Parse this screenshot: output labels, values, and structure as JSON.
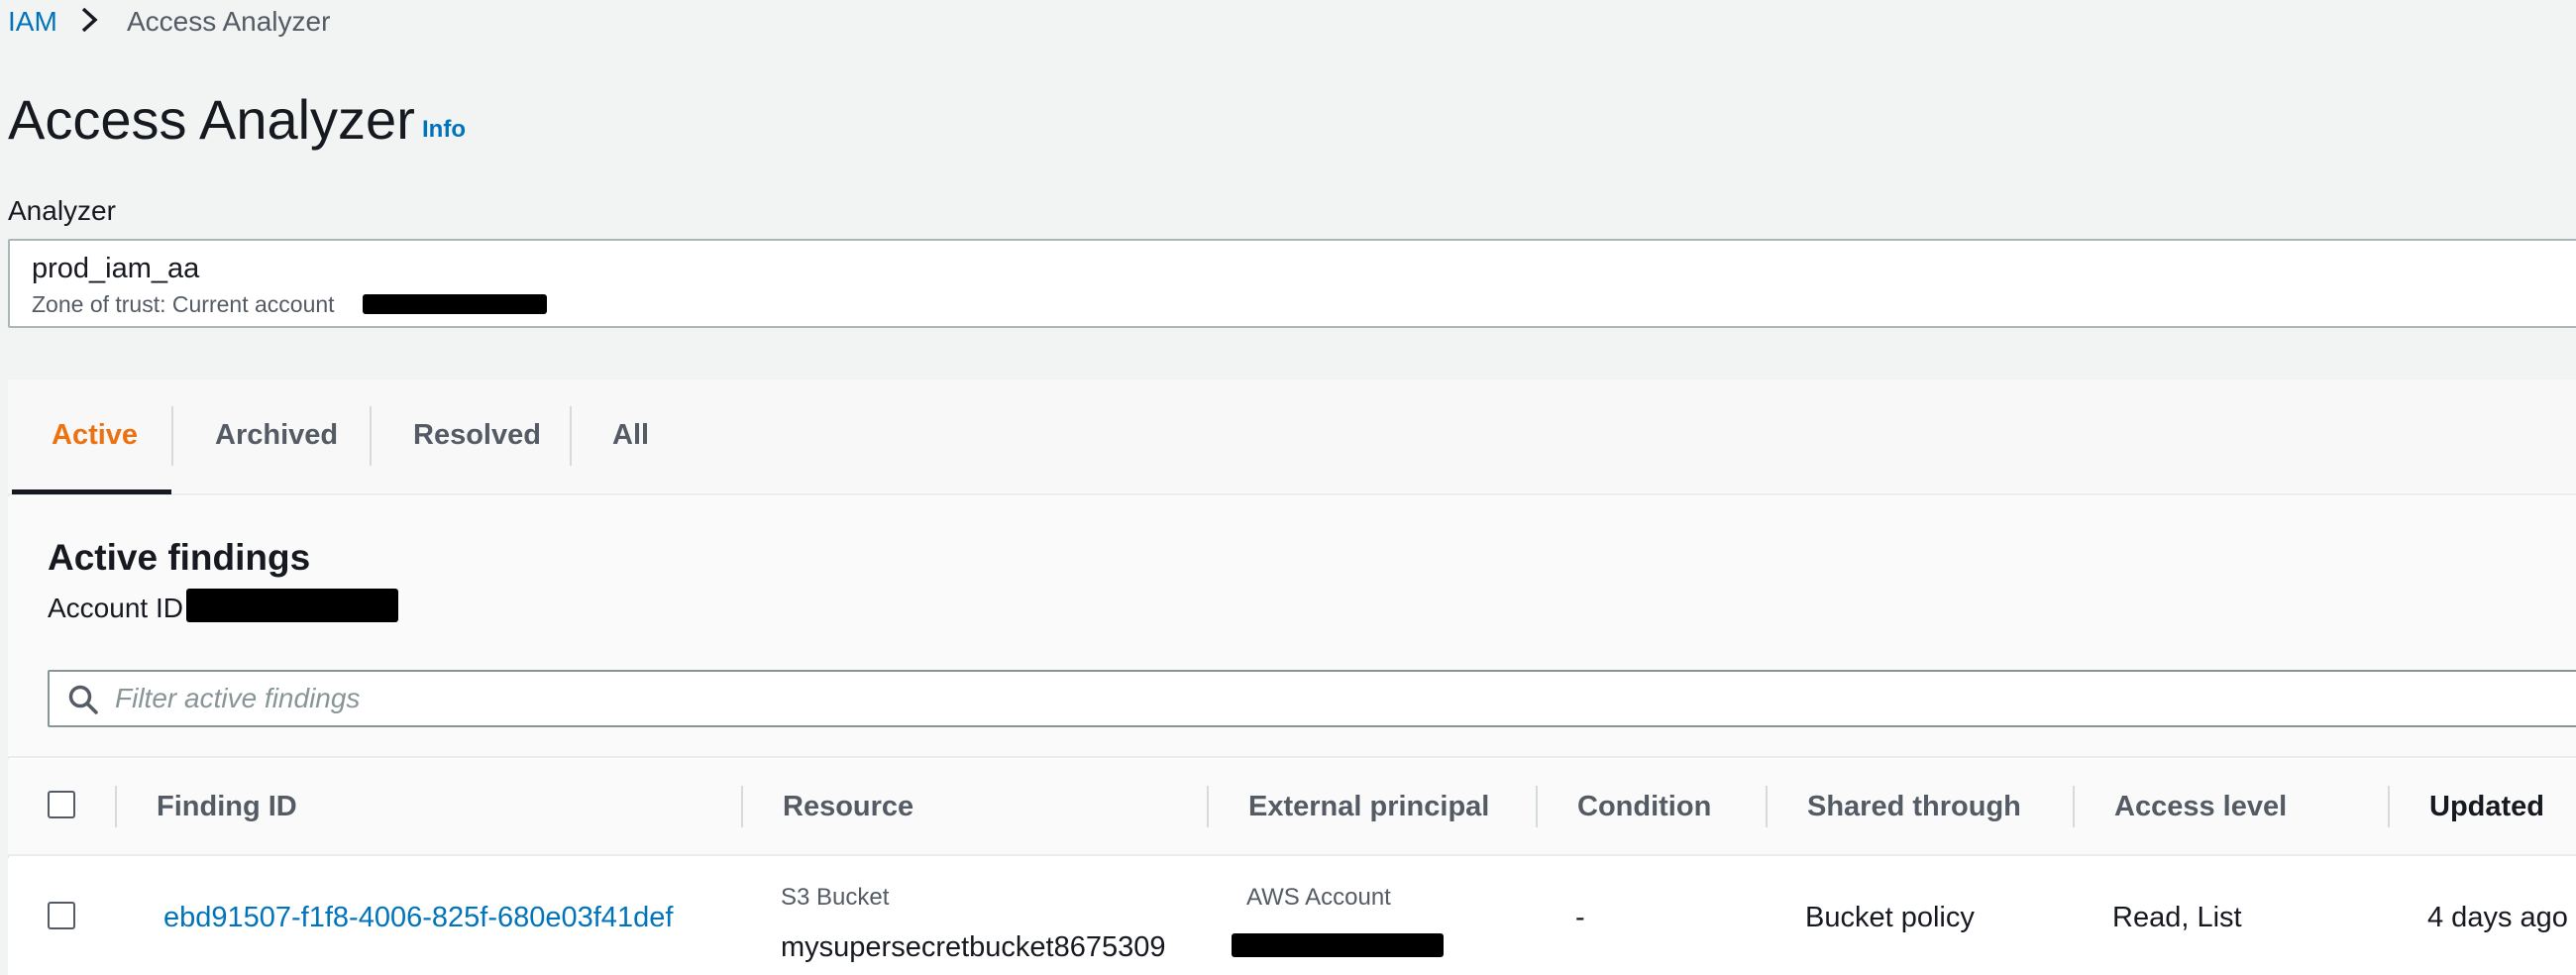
{
  "breadcrumb": {
    "root": "IAM",
    "current": "Access Analyzer"
  },
  "page": {
    "title": "Access Analyzer",
    "info_label": "Info"
  },
  "analyzer": {
    "label": "Analyzer",
    "name": "prod_iam_aa",
    "zone_label": "Zone of trust: Current account"
  },
  "tabs": [
    {
      "label": "Active",
      "active": true
    },
    {
      "label": "Archived",
      "active": false
    },
    {
      "label": "Resolved",
      "active": false
    },
    {
      "label": "All",
      "active": false
    }
  ],
  "findings": {
    "title": "Active findings",
    "account_label": "Account ID",
    "filter_placeholder": "Filter active findings"
  },
  "table": {
    "columns": [
      "Finding ID",
      "Resource",
      "External principal",
      "Condition",
      "Shared through",
      "Access level",
      "Updated"
    ],
    "rows": [
      {
        "finding_id": "ebd91507-f1f8-4006-825f-680e03f41def",
        "resource_type": "S3 Bucket",
        "resource_name": "mysupersecretbucket8675309",
        "principal_type": "AWS Account",
        "condition": "-",
        "shared_through": "Bucket policy",
        "access_level": "Read, List",
        "updated": "4 days ago"
      }
    ]
  },
  "colors": {
    "link": "#0073bb",
    "active_tab": "#ec7211",
    "text": "#16191f",
    "muted": "#545b64"
  },
  "icons": {
    "breadcrumb_separator": "chevron-right-icon",
    "filter": "search-icon"
  }
}
